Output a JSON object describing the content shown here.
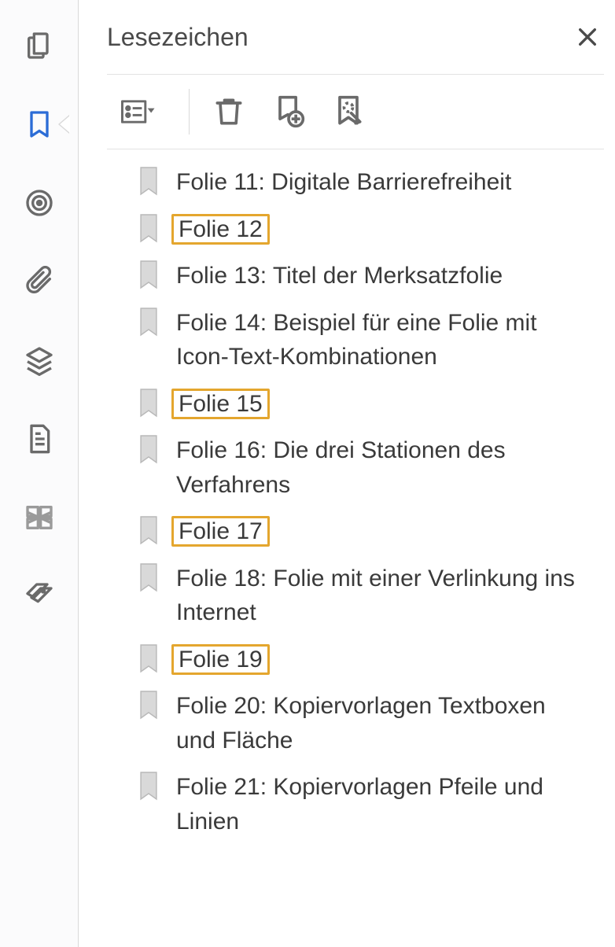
{
  "panel": {
    "title": "Lesezeichen"
  },
  "bookmarks": [
    {
      "label": "Folie 11: Digitale Barrierefreiheit",
      "highlighted": false
    },
    {
      "label": "Folie 12",
      "highlighted": true
    },
    {
      "label": "Folie 13: Titel der Merksatzfolie",
      "highlighted": false
    },
    {
      "label": "Folie 14: Beispiel für eine Folie mit Icon-Text-Kombinationen",
      "highlighted": false
    },
    {
      "label": "Folie 15",
      "highlighted": true
    },
    {
      "label": "Folie 16: Die drei Stationen des Verfahrens",
      "highlighted": false
    },
    {
      "label": "Folie 17",
      "highlighted": true
    },
    {
      "label": "Folie 18: Folie mit einer Verlinkung ins Internet",
      "highlighted": false
    },
    {
      "label": "Folie 19",
      "highlighted": true
    },
    {
      "label": "Folie 20: Kopiervorlagen Textboxen und Fläche",
      "highlighted": false
    },
    {
      "label": "Folie 21: Kopiervorlagen Pfeile und Linien",
      "highlighted": false
    }
  ]
}
